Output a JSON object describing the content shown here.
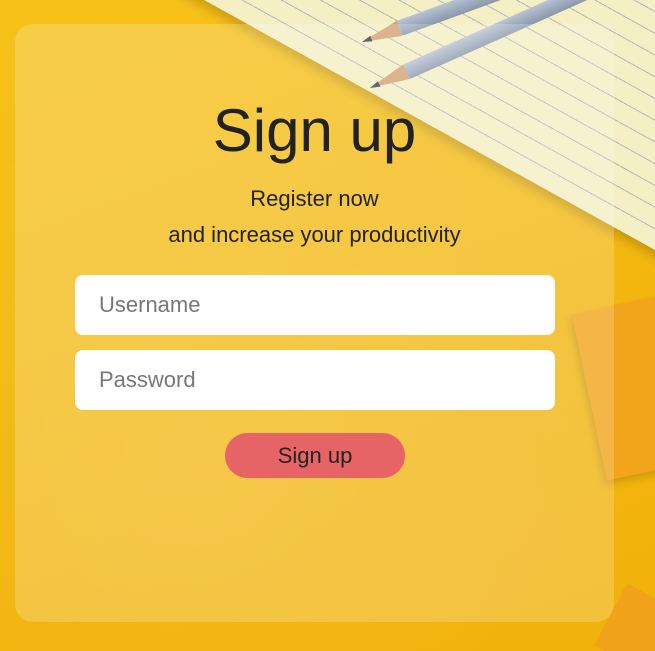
{
  "signup_form": {
    "title": "Sign up",
    "subtitle_line1": "Register now",
    "subtitle_line2": "and increase your productivity",
    "username": {
      "value": "",
      "placeholder": "Username"
    },
    "password": {
      "value": "",
      "placeholder": "Password"
    },
    "submit_label": "Sign up"
  },
  "colors": {
    "background": "#f4ba12",
    "button": "#e66466",
    "input_background": "#ffffff",
    "text": "#222222"
  }
}
